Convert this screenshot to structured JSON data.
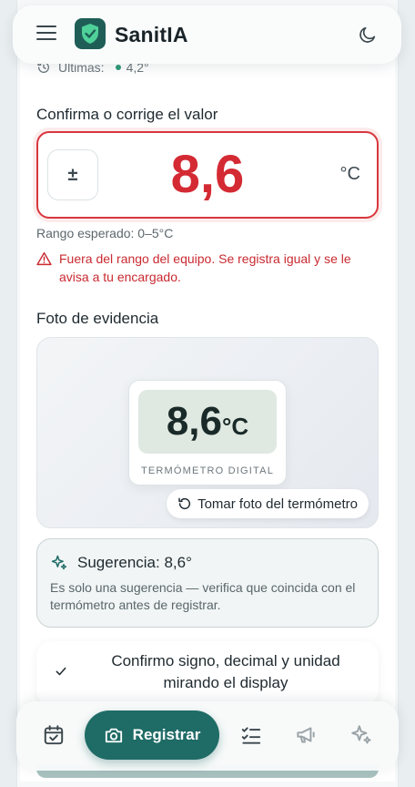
{
  "app": {
    "name": "SanitIA"
  },
  "recent": {
    "label": "Últimas:",
    "value": "4,2°"
  },
  "reading": {
    "section_label": "Confirma o corrige el valor",
    "sign_symbol": "±",
    "value": "8,6",
    "unit": "°C",
    "range_text": "Rango esperado: 0–5°C",
    "warning_text": "Fuera del rango del equipo. Se registra igual y se le avisa a tu encargado."
  },
  "photo": {
    "section_label": "Foto de evidencia",
    "display_value": "8,6",
    "display_unit": "°C",
    "caption": "TERMÓMETRO DIGITAL",
    "button_label": "Tomar foto del termómetro"
  },
  "suggestion": {
    "title": "Sugerencia: 8,6°",
    "note": "Es solo una sugerencia — verifica que coincida con el termómetro antes de registrar."
  },
  "confirm": {
    "text": "Confirmo signo, decimal y unidad mirando el display"
  },
  "nav": {
    "register_label": "Registrar"
  },
  "colors": {
    "accent": "#1f6b66",
    "error": "#d42a33",
    "logo_bg": "#1f5e57"
  }
}
